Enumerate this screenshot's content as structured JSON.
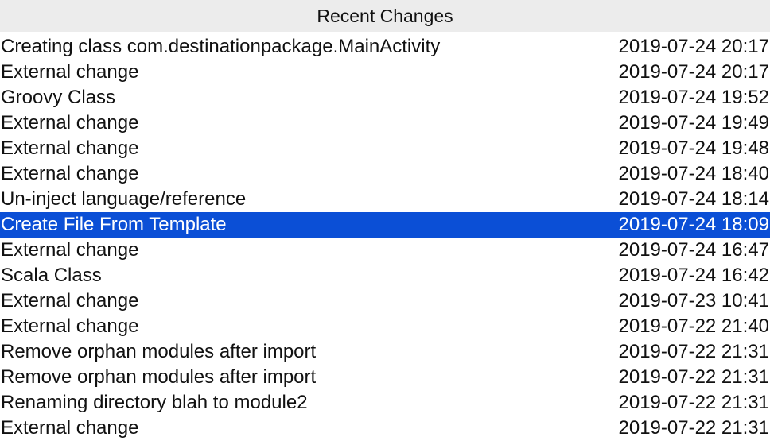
{
  "title": "Recent Changes",
  "selection_color": "#0b4fd6",
  "rows": [
    {
      "name": "",
      "time": "",
      "partial": true
    },
    {
      "name": "Creating class com.destinationpackage.MainActivity",
      "time": "2019-07-24 20:17"
    },
    {
      "name": "External change",
      "time": "2019-07-24 20:17"
    },
    {
      "name": "Groovy Class",
      "time": "2019-07-24 19:52"
    },
    {
      "name": "External change",
      "time": "2019-07-24 19:49"
    },
    {
      "name": "External change",
      "time": "2019-07-24 19:48"
    },
    {
      "name": "External change",
      "time": "2019-07-24 18:40"
    },
    {
      "name": "Un-inject language/reference",
      "time": "2019-07-24 18:14"
    },
    {
      "name": "Create File From Template",
      "time": "2019-07-24 18:09",
      "selected": true
    },
    {
      "name": "External change",
      "time": "2019-07-24 16:47"
    },
    {
      "name": "Scala Class",
      "time": "2019-07-24 16:42"
    },
    {
      "name": "External change",
      "time": "2019-07-23 10:41"
    },
    {
      "name": "External change",
      "time": "2019-07-22 21:40"
    },
    {
      "name": "Remove orphan modules after import",
      "time": "2019-07-22 21:31"
    },
    {
      "name": "Remove orphan modules after import",
      "time": "2019-07-22 21:31"
    },
    {
      "name": "Renaming directory blah to module2",
      "time": "2019-07-22 21:31"
    },
    {
      "name": "External change",
      "time": "2019-07-22 21:31",
      "partial": true
    }
  ]
}
